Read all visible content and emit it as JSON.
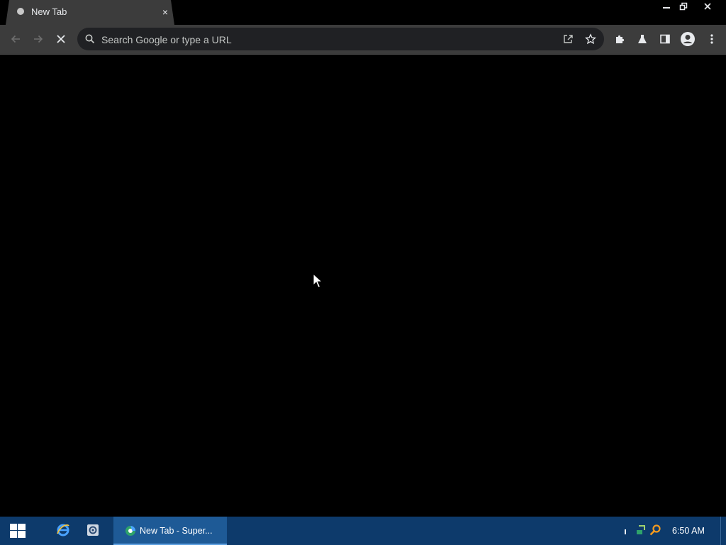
{
  "tab": {
    "title": "New Tab",
    "close_label": "×"
  },
  "window_controls": [
    "minimize",
    "restore",
    "close"
  ],
  "toolbar": {
    "omnibox_placeholder": "Search Google or type a URL",
    "omnibox_value": ""
  },
  "taskbar": {
    "active_item_label": "New Tab - Super...",
    "clock": "6:50 AM"
  },
  "icons": {
    "back": "arrow-left-icon",
    "forward": "arrow-right-icon",
    "stop": "close-icon",
    "search": "search-icon",
    "share": "share-icon",
    "bookmark": "star-icon",
    "extensions": "puzzle-icon",
    "labs": "flask-icon",
    "sidepanel": "side-panel-icon",
    "profile": "account-icon",
    "menu": "kebab-menu-icon"
  },
  "colors": {
    "page_background": "#000000",
    "toolbar": "#3c3c3c",
    "omnibox": "#202124",
    "taskbar": "#0d3a6b",
    "taskbar_active": "#1e5a96"
  }
}
